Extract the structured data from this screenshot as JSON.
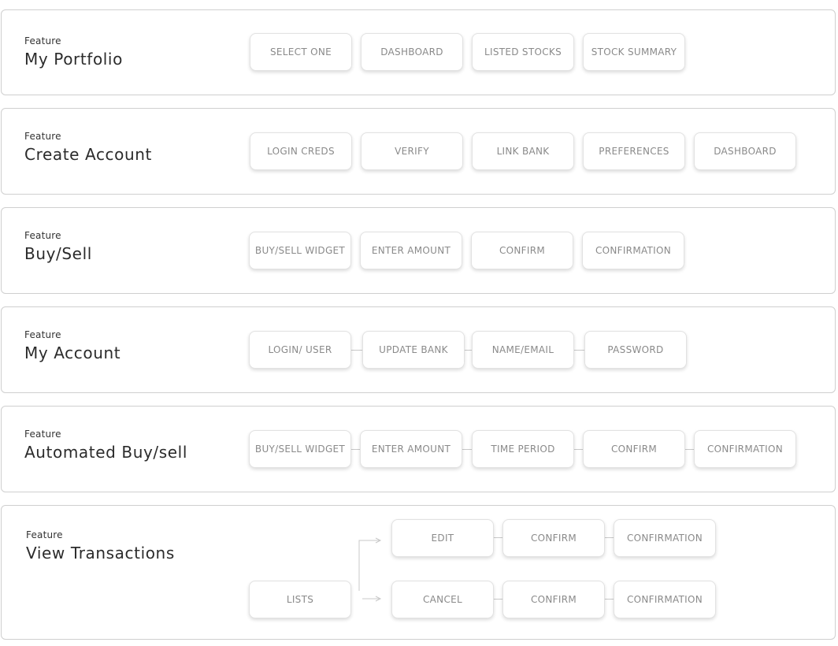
{
  "feature_label": "Feature",
  "features": [
    {
      "title": "My Portfolio",
      "steps": [
        "SELECT ONE",
        "DASHBOARD",
        "LISTED STOCKS",
        "STOCK SUMMARY"
      ]
    },
    {
      "title": "Create Account",
      "steps": [
        "LOGIN CREDS",
        "VERIFY",
        "LINK BANK",
        "PREFERENCES",
        "DASHBOARD"
      ]
    },
    {
      "title": "Buy/Sell",
      "steps": [
        "BUY/SELL WIDGET",
        "ENTER AMOUNT",
        "CONFIRM",
        "CONFIRMATION"
      ]
    },
    {
      "title": "My Account",
      "steps": [
        "LOGIN/ USER",
        "UPDATE BANK",
        "NAME/EMAIL",
        "PASSWORD"
      ]
    },
    {
      "title": "Automated Buy/sell",
      "steps": [
        "BUY/SELL WIDGET",
        "ENTER AMOUNT",
        "TIME PERIOD",
        "CONFIRM",
        "CONFIRMATION"
      ]
    },
    {
      "title": "View Transactions",
      "start": "LISTS",
      "branch_top": [
        "EDIT",
        "CONFIRM",
        "CONFIRMATION"
      ],
      "branch_bottom": [
        "CANCEL",
        "CONFIRM",
        "CONFIRMATION"
      ]
    }
  ]
}
